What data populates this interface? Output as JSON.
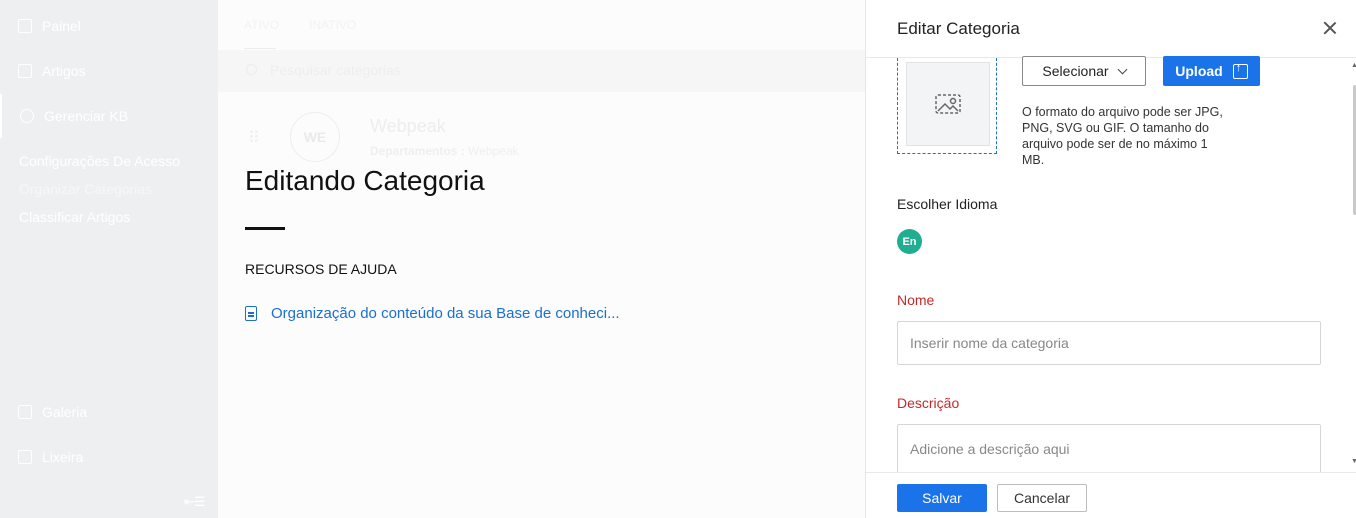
{
  "sidebar": {
    "items": [
      {
        "label": "Painel",
        "icon": "grid-icon"
      },
      {
        "label": "Artigos",
        "icon": "article-icon"
      },
      {
        "label": "Gerenciar KB",
        "icon": "gear-icon"
      }
    ],
    "sub_items": [
      "Configurações De Acesso",
      "Organizar Categorias",
      "Classificar Artigos"
    ],
    "bottom_items": [
      {
        "label": "Galeria",
        "icon": "image-icon"
      },
      {
        "label": "Lixeira",
        "icon": "trash-icon"
      }
    ],
    "collapse_glyph": "⇤☰"
  },
  "main": {
    "tabs": [
      "ATIVO",
      "INATIVO"
    ],
    "search_placeholder": "Pesquisar categorias",
    "category": {
      "avatar": "WE",
      "name": "Webpeak",
      "dept_label": "Departamentos :",
      "dept_value": "Webpeak"
    }
  },
  "help": {
    "title": "Editando Categoria",
    "section": "RECURSOS DE AJUDA",
    "link": "Organização do conteúdo da sua Base de conheci..."
  },
  "panel": {
    "title": "Editar Categoria",
    "select_label": "Selecionar",
    "upload_label": "Upload",
    "format_note": "O formato do arquivo pode ser JPG, PNG, SVG ou GIF. O tamanho do arquivo pode ser de no máximo 1 MB.",
    "language_label": "Escolher Idioma",
    "language_code": "En",
    "language_color": "#1fae8f",
    "name_label": "Nome",
    "name_placeholder": "Inserir nome da categoria",
    "desc_label": "Descrição",
    "desc_placeholder": "Adicione a descrição aqui",
    "save_label": "Salvar",
    "cancel_label": "Cancelar",
    "accent_color": "#1a73e8",
    "required_color": "#c62828"
  }
}
